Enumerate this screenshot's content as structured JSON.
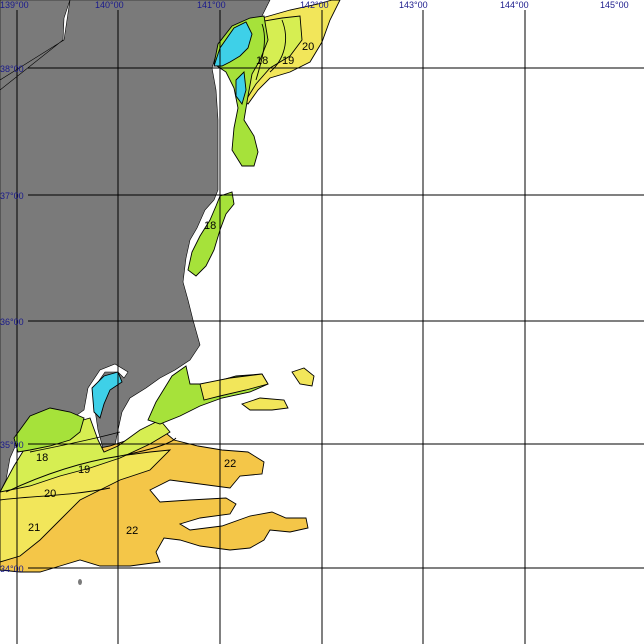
{
  "map": {
    "longitude_labels": [
      "139°00",
      "140°00",
      "141°00",
      "142°00",
      "143°00",
      "144°00",
      "145°00"
    ],
    "latitude_labels": [
      "38°00",
      "37°00",
      "36°00",
      "35°00",
      "34°00"
    ],
    "isotherm_labels": [
      "18",
      "19",
      "20",
      "18",
      "18",
      "19",
      "20",
      "21",
      "22",
      "22"
    ],
    "colors": {
      "land": "#7a7a7a",
      "sea": "#ffffff",
      "grid": "#000000",
      "label_text": "#1a1a8c",
      "sst_cyan": "#3ed0e8",
      "sst_green": "#a6e23a",
      "sst_yellowgreen": "#d6ee52",
      "sst_yellow": "#f2e65a",
      "sst_orange": "#f4c648"
    }
  }
}
